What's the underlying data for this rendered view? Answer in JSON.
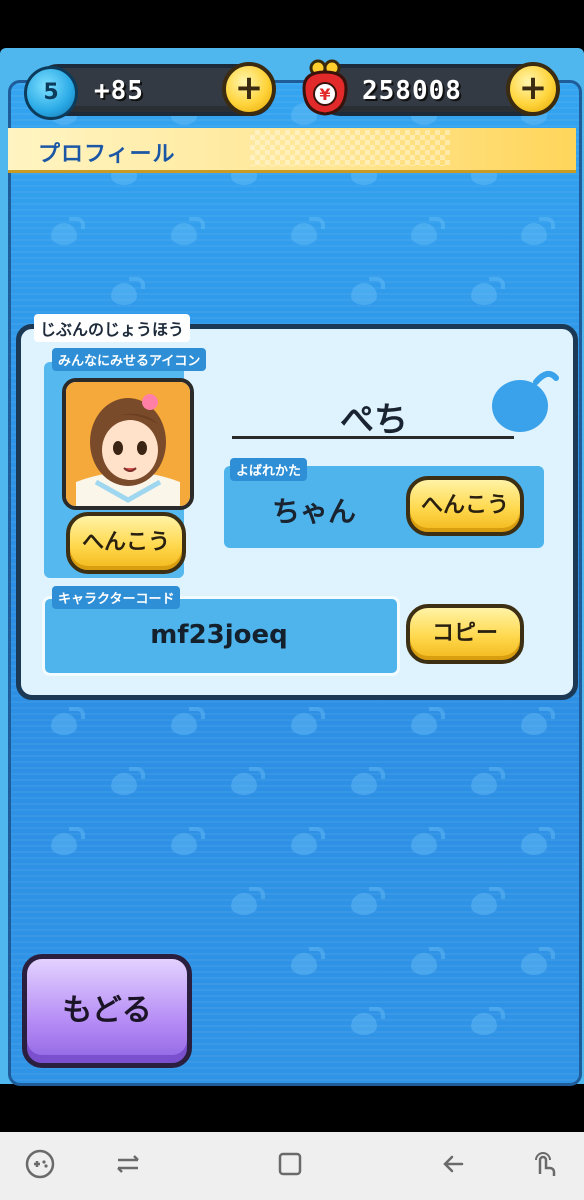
{
  "top_bar": {
    "level": "5",
    "spirit_points": "+85",
    "money": "258008",
    "plus_symbol": "+"
  },
  "header": {
    "title": "プロフィール"
  },
  "info_card": {
    "section_label": "じぶんのじょうほう",
    "icon_section_label": "みんなにみせるアイコン",
    "icon_change_button": "へんこう",
    "player_name": "ぺち",
    "honorific_label": "よばれかた",
    "honorific_value": "ちゃん",
    "honorific_change_button": "へんこう",
    "character_code_label": "キャラクターコード",
    "character_code_value": "mf23joeq",
    "copy_button": "コピー"
  },
  "footer": {
    "back_button": "もどる"
  },
  "android_nav": {
    "icons": [
      "game-tools-icon",
      "recent-apps-icon",
      "home-icon",
      "back-icon",
      "touch-icon"
    ]
  },
  "colors": {
    "frame_blue": "#2f94e6",
    "yellow_button": "#ffd84d",
    "back_button_purple": "#b58cf5",
    "dark_outline": "#1b3954"
  }
}
